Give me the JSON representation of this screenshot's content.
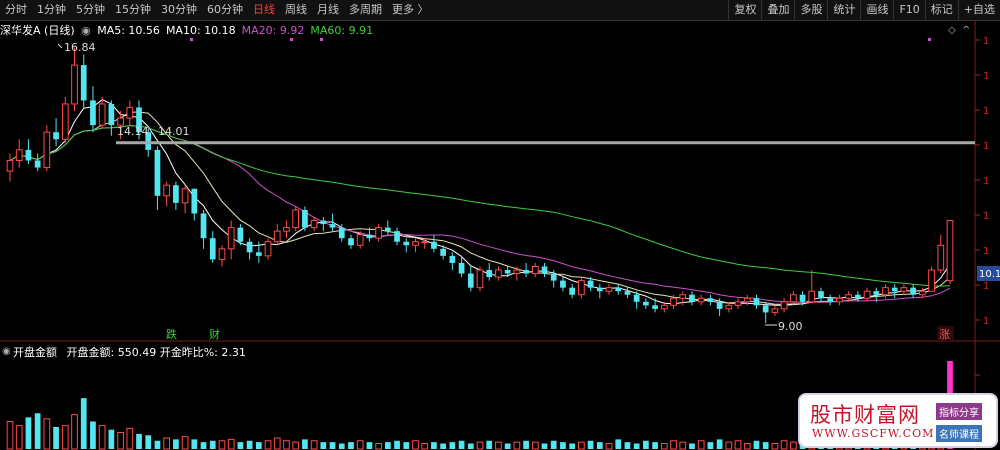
{
  "toolbar": {
    "tabs": [
      "分时",
      "1分钟",
      "5分钟",
      "15分钟",
      "30分钟",
      "60分钟",
      "日线",
      "周线",
      "月线",
      "多周期",
      "更多 〉"
    ],
    "active_index": 6,
    "actions": [
      "复权",
      "叠加",
      "多股",
      "统计",
      "画线",
      "F10",
      "标记",
      "+自选"
    ]
  },
  "price_panel": {
    "stock_name": "深华发A (日线)",
    "ma_labels": [
      {
        "text": "MA5: 10.56",
        "color": "#ffffff"
      },
      {
        "text": "MA10: 10.18",
        "color": "#ffffff"
      },
      {
        "text": "MA20: 9.92",
        "color": "#d14fd1"
      },
      {
        "text": "MA60: 9.91",
        "color": "#3ecf3e"
      }
    ],
    "high_label": "16.84",
    "low_label": "9.00",
    "hline_labels": [
      "14.14",
      "14.01"
    ],
    "last_price_label": "10.1",
    "signal_labels": [
      "跌",
      "财",
      "涨"
    ]
  },
  "volume_panel": {
    "title": "开盘金额",
    "line": "开盘金额: 550.49  开金昨比%: 2.31"
  },
  "watermark": {
    "title": "股市财富网",
    "url": "WWW.GSCFW.COM",
    "tag1": "指标分享",
    "tag2": "名师课程"
  },
  "colors": {
    "up": "#ff4a4a",
    "down": "#53e5f0",
    "ma5": "#ffffff",
    "ma10": "#e8e0b0",
    "ma20": "#d14fd1",
    "ma60": "#3ecf3e",
    "hline": "#a8a8a8"
  },
  "chart_data": {
    "type": "candlestick",
    "hline_value": 14.1,
    "bars": [
      [
        13.3,
        13.8,
        13.0,
        13.6
      ],
      [
        13.6,
        14.2,
        13.4,
        13.9
      ],
      [
        13.9,
        14.2,
        13.5,
        13.6
      ],
      [
        13.6,
        13.8,
        13.3,
        13.4
      ],
      [
        13.4,
        14.6,
        13.3,
        14.4
      ],
      [
        14.4,
        14.8,
        14.0,
        14.2
      ],
      [
        14.2,
        15.4,
        14.1,
        15.2
      ],
      [
        15.2,
        16.8,
        15.0,
        16.3
      ],
      [
        16.3,
        16.6,
        15.1,
        15.3
      ],
      [
        15.3,
        15.7,
        14.4,
        14.6
      ],
      [
        14.6,
        15.4,
        14.5,
        15.2
      ],
      [
        15.2,
        15.3,
        14.3,
        14.6
      ],
      [
        14.6,
        15.0,
        14.2,
        14.8
      ],
      [
        14.8,
        15.3,
        14.6,
        15.1
      ],
      [
        15.1,
        15.3,
        14.2,
        14.4
      ],
      [
        14.4,
        14.5,
        13.7,
        13.9
      ],
      [
        13.9,
        14.0,
        12.2,
        12.6
      ],
      [
        12.6,
        13.0,
        12.3,
        12.9
      ],
      [
        12.9,
        13.0,
        12.2,
        12.4
      ],
      [
        12.4,
        12.9,
        12.1,
        12.8
      ],
      [
        12.8,
        12.8,
        11.9,
        12.1
      ],
      [
        12.1,
        12.2,
        11.1,
        11.4
      ],
      [
        11.4,
        11.6,
        10.7,
        10.8
      ],
      [
        10.8,
        11.2,
        10.6,
        11.1
      ],
      [
        11.1,
        11.9,
        10.8,
        11.7
      ],
      [
        11.7,
        11.8,
        11.2,
        11.3
      ],
      [
        11.3,
        11.4,
        10.8,
        11.0
      ],
      [
        11.0,
        11.3,
        10.7,
        10.9
      ],
      [
        10.9,
        11.4,
        10.8,
        11.3
      ],
      [
        11.3,
        11.8,
        11.2,
        11.6
      ],
      [
        11.6,
        11.9,
        11.4,
        11.7
      ],
      [
        11.7,
        12.3,
        11.6,
        12.2
      ],
      [
        12.2,
        12.3,
        11.6,
        11.7
      ],
      [
        11.7,
        12.0,
        11.6,
        11.9
      ],
      [
        11.9,
        12.0,
        11.6,
        11.8
      ],
      [
        11.8,
        12.1,
        11.6,
        11.7
      ],
      [
        11.7,
        11.8,
        11.3,
        11.4
      ],
      [
        11.4,
        11.5,
        11.1,
        11.2
      ],
      [
        11.2,
        11.6,
        11.1,
        11.5
      ],
      [
        11.5,
        11.7,
        11.3,
        11.4
      ],
      [
        11.4,
        11.8,
        11.3,
        11.7
      ],
      [
        11.7,
        11.9,
        11.5,
        11.6
      ],
      [
        11.6,
        11.7,
        11.2,
        11.3
      ],
      [
        11.3,
        11.4,
        11.0,
        11.2
      ],
      [
        11.2,
        11.4,
        11.0,
        11.3
      ],
      [
        11.3,
        11.4,
        11.1,
        11.3
      ],
      [
        11.3,
        11.5,
        11.0,
        11.1
      ],
      [
        11.1,
        11.2,
        10.8,
        10.9
      ],
      [
        10.9,
        11.0,
        10.5,
        10.7
      ],
      [
        10.7,
        10.9,
        10.3,
        10.4
      ],
      [
        10.4,
        10.6,
        9.9,
        10.0
      ],
      [
        10.0,
        10.6,
        9.9,
        10.5
      ],
      [
        10.5,
        10.7,
        10.2,
        10.3
      ],
      [
        10.3,
        10.6,
        10.2,
        10.5
      ],
      [
        10.5,
        10.6,
        10.3,
        10.4
      ],
      [
        10.4,
        10.6,
        10.2,
        10.5
      ],
      [
        10.5,
        10.7,
        10.3,
        10.4
      ],
      [
        10.4,
        10.7,
        10.3,
        10.6
      ],
      [
        10.6,
        10.7,
        10.3,
        10.4
      ],
      [
        10.4,
        10.5,
        10.0,
        10.2
      ],
      [
        10.2,
        10.3,
        9.9,
        10.0
      ],
      [
        10.0,
        10.1,
        9.7,
        9.8
      ],
      [
        9.8,
        10.3,
        9.7,
        10.2
      ],
      [
        10.2,
        10.3,
        9.9,
        10.0
      ],
      [
        10.0,
        10.1,
        9.7,
        9.9
      ],
      [
        9.9,
        10.1,
        9.8,
        10.0
      ],
      [
        10.0,
        10.1,
        9.8,
        9.9
      ],
      [
        9.9,
        10.0,
        9.7,
        9.8
      ],
      [
        9.8,
        9.9,
        9.4,
        9.6
      ],
      [
        9.6,
        9.7,
        9.4,
        9.5
      ],
      [
        9.5,
        9.7,
        9.3,
        9.4
      ],
      [
        9.4,
        9.6,
        9.3,
        9.5
      ],
      [
        9.5,
        9.8,
        9.4,
        9.7
      ],
      [
        9.7,
        9.9,
        9.5,
        9.8
      ],
      [
        9.8,
        9.9,
        9.5,
        9.6
      ],
      [
        9.6,
        9.8,
        9.5,
        9.7
      ],
      [
        9.7,
        9.8,
        9.5,
        9.6
      ],
      [
        9.6,
        9.7,
        9.2,
        9.4
      ],
      [
        9.4,
        9.6,
        9.3,
        9.5
      ],
      [
        9.5,
        9.7,
        9.4,
        9.6
      ],
      [
        9.6,
        9.8,
        9.5,
        9.7
      ],
      [
        9.7,
        9.8,
        9.4,
        9.5
      ],
      [
        9.5,
        9.6,
        9.0,
        9.3
      ],
      [
        9.3,
        9.5,
        9.2,
        9.4
      ],
      [
        9.4,
        9.7,
        9.3,
        9.6
      ],
      [
        9.6,
        9.9,
        9.5,
        9.8
      ],
      [
        9.8,
        9.9,
        9.5,
        9.6
      ],
      [
        9.6,
        10.5,
        9.6,
        9.9
      ],
      [
        9.9,
        10.0,
        9.6,
        9.7
      ],
      [
        9.7,
        9.8,
        9.5,
        9.6
      ],
      [
        9.6,
        9.8,
        9.5,
        9.7
      ],
      [
        9.7,
        9.9,
        9.6,
        9.8
      ],
      [
        9.8,
        9.9,
        9.6,
        9.7
      ],
      [
        9.7,
        10.0,
        9.6,
        9.9
      ],
      [
        9.9,
        10.0,
        9.6,
        9.8
      ],
      [
        9.8,
        10.1,
        9.7,
        10.0
      ],
      [
        10.0,
        10.1,
        9.7,
        9.9
      ],
      [
        9.9,
        10.1,
        9.8,
        10.0
      ],
      [
        10.0,
        10.1,
        9.7,
        9.8
      ],
      [
        9.8,
        10.0,
        9.7,
        9.9
      ],
      [
        9.9,
        10.6,
        9.9,
        10.5
      ],
      [
        10.5,
        11.5,
        10.4,
        11.2
      ],
      [
        10.2,
        11.9,
        10.1,
        11.9
      ]
    ],
    "volumes": [
      40,
      34,
      46,
      52,
      44,
      32,
      34,
      50,
      74,
      40,
      34,
      28,
      24,
      30,
      22,
      20,
      12,
      16,
      14,
      18,
      14,
      10,
      12,
      12,
      14,
      10,
      12,
      10,
      12,
      16,
      12,
      10,
      14,
      12,
      10,
      10,
      8,
      10,
      12,
      10,
      8,
      10,
      12,
      10,
      12,
      8,
      10,
      8,
      10,
      12,
      8,
      10,
      12,
      10,
      8,
      10,
      12,
      10,
      8,
      12,
      10,
      8,
      10,
      12,
      10,
      8,
      14,
      10,
      8,
      12,
      10,
      8,
      12,
      10,
      8,
      12,
      10,
      14,
      10,
      12,
      8,
      12,
      10,
      8,
      12,
      10,
      14,
      10,
      12,
      8,
      12,
      10,
      8,
      10,
      12,
      10,
      12,
      14,
      16,
      20,
      30,
      46,
      128
    ]
  }
}
